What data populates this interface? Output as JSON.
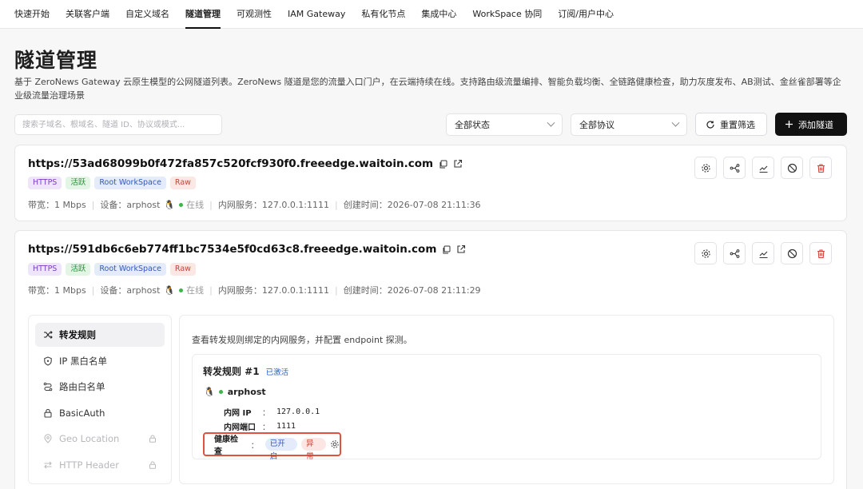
{
  "nav": {
    "items": [
      "快速开始",
      "关联客户端",
      "自定义域名",
      "隧道管理",
      "可观测性",
      "IAM Gateway",
      "私有化节点",
      "集成中心",
      "WorkSpace 协同",
      "订阅/用户中心"
    ],
    "active_index": 3
  },
  "page": {
    "title": "隧道管理",
    "description": "基于 ZeroNews Gateway 云原生模型的公网隧道列表。ZeroNews 隧道是您的流量入口门户，在云端持续在线。支持路由级流量编排、智能负载均衡、全链路健康检查，助力灰度发布、AB测试、金丝雀部署等企业级流量治理场景"
  },
  "filters": {
    "search_placeholder": "搜索子域名、根域名、隧道 ID、协议或模式...",
    "status_select": "全部状态",
    "protocol_select": "全部协议",
    "reset_label": "重置筛选",
    "add_label": "添加隧道"
  },
  "tunnels": [
    {
      "url": "https://53ad68099b0f472fa857c520fcf930f0.freeedge.waitoin.com",
      "tags": [
        "HTTPS",
        "活跃",
        "Root WorkSpace",
        "Raw"
      ],
      "bandwidth": "带宽：1 Mbps",
      "device_label": "设备：",
      "device": "arphost",
      "status": "在线",
      "service": "内网服务：127.0.0.1:1111",
      "created": "创建时间：2026-07-08 21:11:36"
    },
    {
      "url": "https://591db6c6eb774ff1bc7534e5f0cd63c8.freeedge.waitoin.com",
      "tags": [
        "HTTPS",
        "活跃",
        "Root WorkSpace",
        "Raw"
      ],
      "bandwidth": "带宽：1 Mbps",
      "device_label": "设备：",
      "device": "arphost",
      "status": "在线",
      "service": "内网服务：127.0.0.1:1111",
      "created": "创建时间：2026-07-08 21:11:29"
    }
  ],
  "detail": {
    "nav": [
      {
        "label": "转发规则",
        "icon": "shuffle-icon"
      },
      {
        "label": "IP 黑白名单",
        "icon": "shield-icon"
      },
      {
        "label": "路由白名单",
        "icon": "route-icon"
      },
      {
        "label": "BasicAuth",
        "icon": "lock-icon"
      },
      {
        "label": "Geo Location",
        "icon": "location-pin-icon"
      },
      {
        "label": "HTTP Header",
        "icon": "swap-arrows-icon"
      }
    ],
    "description": "查看转发规则绑定的内网服务，并配置 endpoint 探测。",
    "rule": {
      "title": "转发规则 #1",
      "state": "已激活",
      "host": "arphost",
      "ip_label": "内网 IP",
      "ip": "127.0.0.1",
      "port_label": "内网端口",
      "port": "1111",
      "colon": "：",
      "health_label": "健康检查",
      "health_enabled": "已开启",
      "health_status": "异常"
    }
  },
  "colors": {
    "accent_dark": "#121212",
    "online_green": "#3cb54a",
    "highlight_red": "#e0523f",
    "activated_blue": "#2f62d6"
  }
}
